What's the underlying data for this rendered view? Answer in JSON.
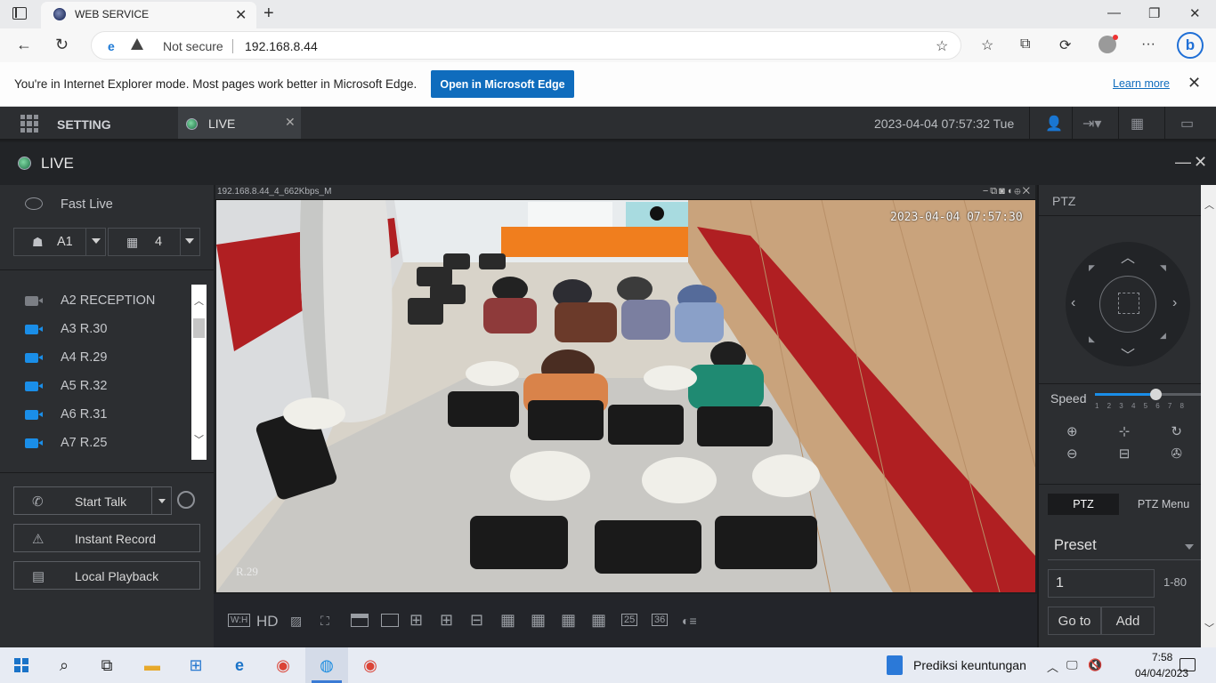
{
  "browser": {
    "tab_title": "WEB SERVICE",
    "address_security": "Not secure",
    "address_url": "192.168.8.44",
    "ie_mode_message": "You're in Internet Explorer mode. Most pages work better in Microsoft Edge.",
    "open_edge_label": "Open in Microsoft Edge",
    "learn_more_label": "Learn more"
  },
  "app_header": {
    "setting_label": "SETTING",
    "live_tab_label": "LIVE",
    "datetime": "2023-04-04 07:57:32 Tue"
  },
  "live_window": {
    "title": "LIVE"
  },
  "left_panel": {
    "fast_live_label": "Fast Live",
    "channel_select": "A1",
    "layout_select": "4",
    "cameras": [
      {
        "label": "A2 RECEPTION",
        "icon": "camera-gray"
      },
      {
        "label": "A3 R.30",
        "icon": "camera-blue"
      },
      {
        "label": "A4 R.29",
        "icon": "camera-blue"
      },
      {
        "label": "A5 R.32",
        "icon": "camera-blue"
      },
      {
        "label": "A6 R.31",
        "icon": "camera-blue"
      },
      {
        "label": "A7 R.25",
        "icon": "camera-blue"
      }
    ],
    "start_talk_label": "Start Talk",
    "instant_record_label": "Instant Record",
    "local_playback_label": "Local Playback"
  },
  "video": {
    "stream_label": "192.168.8.44_4_662Kbps_M",
    "osd_time": "2023-04-04 07:57:30",
    "osd_name": "R.29",
    "toolbar_wh": "W:H",
    "toolbar_hd": "HD",
    "layout_25": "25",
    "layout_36": "36"
  },
  "ptz": {
    "title": "PTZ",
    "speed_label": "Speed",
    "speed_ticks": "12345678",
    "speed_value": 5,
    "speed_max": 8,
    "tab_ptz": "PTZ",
    "tab_ptz_menu": "PTZ Menu",
    "preset_label": "Preset",
    "preset_value": "1",
    "preset_range": "1-80",
    "goto_label": "Go to",
    "add_label": "Add"
  },
  "taskbar": {
    "notification_text": "Prediksi keuntungan",
    "time": "7:58",
    "date": "04/04/2023"
  }
}
